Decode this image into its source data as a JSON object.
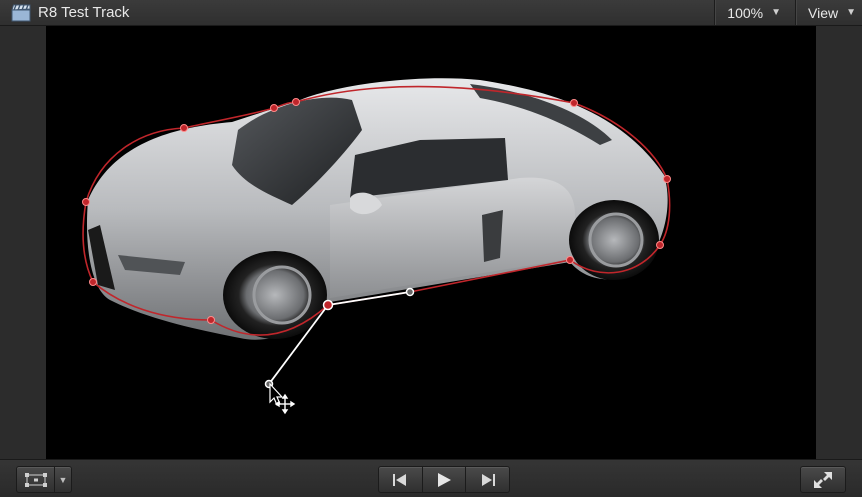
{
  "header": {
    "title": "R8 Test Track",
    "zoom": "100%",
    "view_label": "View"
  },
  "icons": {
    "title": "clapperboard-icon",
    "zoom_caret": "caret-down-icon",
    "view_caret": "caret-down-icon",
    "transform": "transform-tool-icon",
    "transform_menu": "caret-down-icon",
    "prev": "skip-back-icon",
    "play": "play-icon",
    "next": "skip-forward-icon",
    "fullscreen": "fullscreen-icon"
  },
  "colors": {
    "mask_outline": "#c0262b",
    "canvas": "#000000",
    "chrome": "#2b2b2b"
  }
}
